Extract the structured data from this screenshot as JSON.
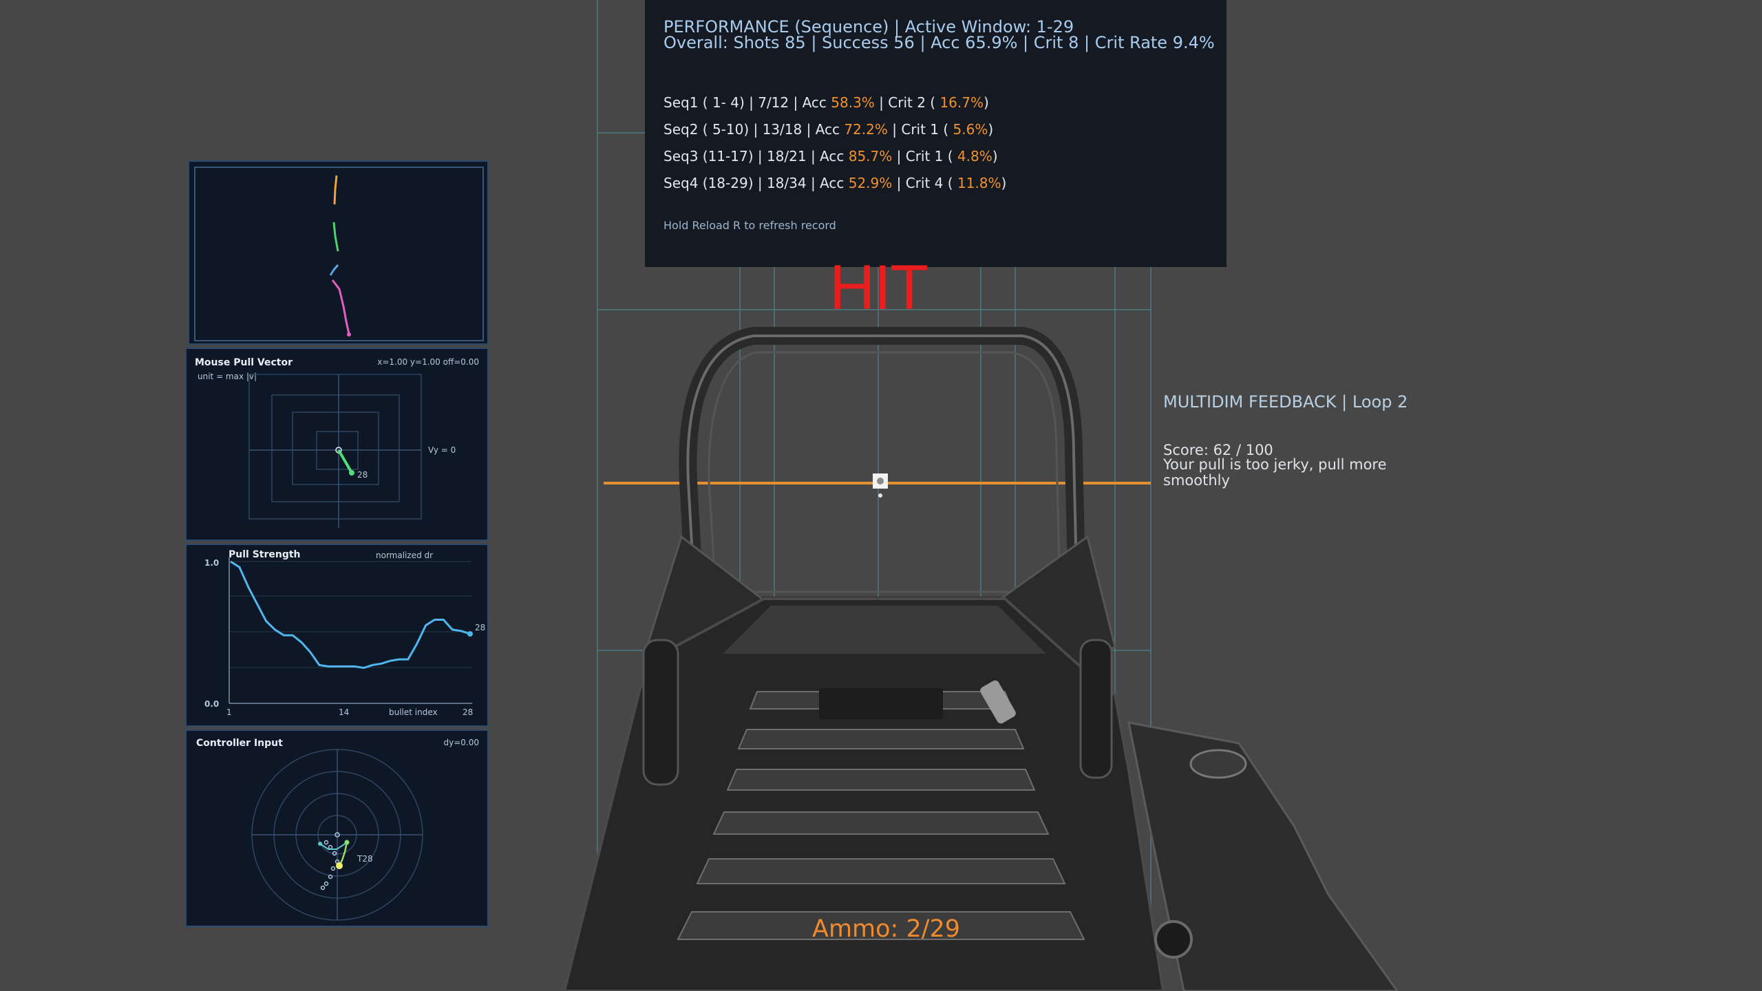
{
  "performance": {
    "title": "PERFORMANCE (Sequence) | Active Window: 1-29",
    "overall": "Overall: Shots 85 | Success 56 | Acc 65.9% | Crit 8 | Crit Rate 9.4%",
    "sequences": [
      {
        "pre": "Seq1 ( 1- 4) |  7/12 | Acc ",
        "acc": "58.3%",
        "mid": " | Crit 2 ( ",
        "crit": "16.7%",
        "post": ")"
      },
      {
        "pre": "Seq2 ( 5-10) | 13/18 | Acc ",
        "acc": "72.2%",
        "mid": " | Crit 1 (  ",
        "crit": "5.6%",
        "post": ")"
      },
      {
        "pre": "Seq3 (11-17) | 18/21 | Acc ",
        "acc": "85.7%",
        "mid": " | Crit 1 (  ",
        "crit": "4.8%",
        "post": ")"
      },
      {
        "pre": "Seq4 (18-29) | 18/34 | Acc ",
        "acc": "52.9%",
        "mid": " | Crit 4 ( ",
        "crit": "11.8%",
        "post": ")"
      }
    ],
    "hint": "Hold Reload R to refresh record"
  },
  "hit_text": "HIT",
  "feedback": {
    "title": "MULTIDIM FEEDBACK | Loop 2",
    "score": "Score: 62 / 100",
    "message": "Your pull is too jerky, pull more smoothly"
  },
  "ammo": "Ammo: 2/29",
  "mouse_pull": {
    "title": "Mouse Pull Vector",
    "readout": "x=1.00 y=1.00 off=0.00",
    "unit": "unit = max |v|",
    "axis_label": "Vy = 0",
    "marker": "28"
  },
  "pull_strength": {
    "title": "Pull Strength",
    "subtitle": "normalized dr",
    "y_top": "1.0",
    "y_bottom": "0.0",
    "x_ticks": [
      "1",
      "14",
      "28"
    ],
    "x_label": "bullet index",
    "end_label": "28",
    "values": [
      1.0,
      0.96,
      0.82,
      0.7,
      0.58,
      0.52,
      0.48,
      0.48,
      0.43,
      0.36,
      0.27,
      0.26,
      0.26,
      0.26,
      0.26,
      0.25,
      0.27,
      0.28,
      0.3,
      0.31,
      0.31,
      0.42,
      0.55,
      0.59,
      0.59,
      0.52,
      0.51,
      0.49
    ]
  },
  "controller": {
    "title": "Controller Input",
    "readout": "dy=0.00",
    "marker": "T28"
  },
  "colors": {
    "orange": "#f3922c",
    "hit_red": "#e81e1e",
    "panel_bg": "#0e1726",
    "curve_blue": "#4fb6ee"
  }
}
